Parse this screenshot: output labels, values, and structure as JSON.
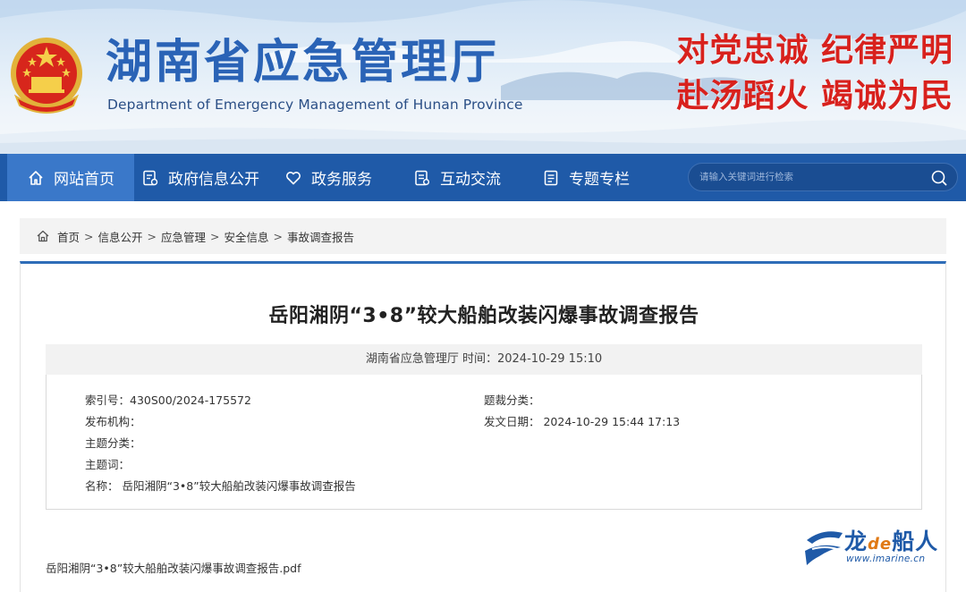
{
  "header": {
    "title": "湖南省应急管理厅",
    "subtitle": "Department of Emergency Management of Hunan Province",
    "slogan_line1": "对党忠诚  纪律严明",
    "slogan_line2": "赴汤蹈火  竭诚为民",
    "colors": {
      "title": "#2a63b6",
      "slogan": "#d8211d"
    }
  },
  "nav": {
    "items": [
      {
        "label": "网站首页",
        "icon": "home-icon",
        "active": true
      },
      {
        "label": "政府信息公开",
        "icon": "document-icon",
        "active": false
      },
      {
        "label": "政务服务",
        "icon": "heart-icon",
        "active": false
      },
      {
        "label": "互动交流",
        "icon": "chat-icon",
        "active": false
      },
      {
        "label": "专题专栏",
        "icon": "list-icon",
        "active": false
      }
    ],
    "search_placeholder": "请输入关键词进行检索",
    "colors": {
      "bar": "#1f5aa8",
      "active": "#3a78c9"
    }
  },
  "breadcrumb": {
    "items": [
      "首页",
      "信息公开",
      "应急管理",
      "安全信息",
      "事故调查报告"
    ],
    "separator": ">"
  },
  "article": {
    "title": "岳阳湘阴“3•8”较大船舶改装闪爆事故调查报告",
    "meta": "湖南省应急管理厅  时间：2024-10-29 15:10",
    "info": {
      "index_no": "索引号：430S00/2024-175572",
      "category": "题裁分类：",
      "publisher": "发布机构：",
      "issue_date": "发文日期：  2024-10-29 15:44 17:13",
      "topic_category": "主题分类：",
      "keywords": "主题词：",
      "name": "名称：  岳阳湘阴“3•8”较大船舶改装闪爆事故调查报告"
    },
    "attachment": "岳阳湘阴“3•8”较大船舶改装闪爆事故调查报告.pdf"
  },
  "watermark": {
    "brand_pre": "龙",
    "brand_de": "de",
    "brand_post": "船人",
    "url": "www.imarine.cn"
  }
}
